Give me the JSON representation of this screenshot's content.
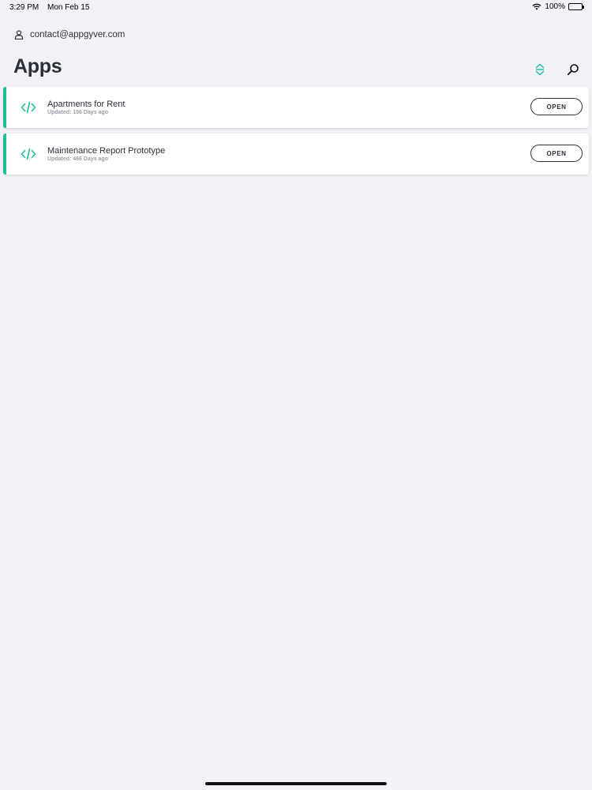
{
  "status_bar": {
    "time": "3:29 PM",
    "date": "Mon Feb 15",
    "battery_text": "100%",
    "battery_level": 1.0
  },
  "account": {
    "email": "contact@appgyver.com",
    "icon": "user-icon"
  },
  "header": {
    "title": "Apps",
    "sort_icon": "sort-icon",
    "search_icon": "search-icon"
  },
  "apps": [
    {
      "name": "Apartments for Rent",
      "updated": "Updated: 156 Days ago",
      "button_label": "OPEN"
    },
    {
      "name": "Maintenance Report Prototype",
      "updated": "Updated: 466 Days ago",
      "button_label": "OPEN"
    }
  ],
  "colors": {
    "accent": "#1fbf9b",
    "background": "#f2f2f7",
    "text": "#2b2f38"
  }
}
